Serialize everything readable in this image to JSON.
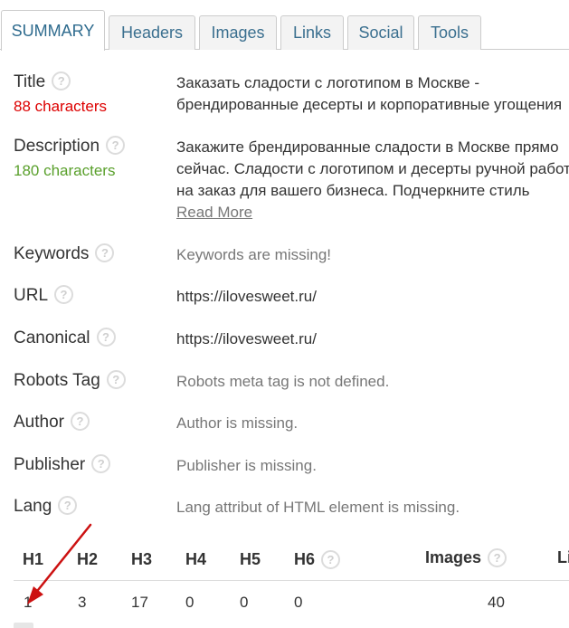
{
  "tabs": [
    {
      "label": "SUMMARY",
      "active": true
    },
    {
      "label": "Headers"
    },
    {
      "label": "Images"
    },
    {
      "label": "Links"
    },
    {
      "label": "Social"
    },
    {
      "label": "Tools"
    }
  ],
  "help_glyph": "?",
  "title": {
    "label": "Title",
    "count": "88 characters",
    "lines": [
      "Заказать сладости с логотипом в Москве -",
      "брендированные десерты и корпоративные угощения"
    ]
  },
  "description": {
    "label": "Description",
    "count": "180 characters",
    "lines": [
      "Закажите брендированные сладости в Москве прямо",
      "сейчас. Сладости с логотипом и десерты ручной работы",
      "на заказ для вашего бизнеса. Подчеркните стиль"
    ],
    "read_more": "Read More"
  },
  "keywords": {
    "label": "Keywords",
    "value": "Keywords are missing!"
  },
  "url": {
    "label": "URL",
    "value": "https://ilovesweet.ru/"
  },
  "canonical": {
    "label": "Canonical",
    "value": "https://ilovesweet.ru/"
  },
  "robots": {
    "label": "Robots Tag",
    "value": "Robots meta tag is not defined."
  },
  "author": {
    "label": "Author",
    "value": "Author is missing."
  },
  "publisher": {
    "label": "Publisher",
    "value": "Publisher is missing."
  },
  "lang": {
    "label": "Lang",
    "value": "Lang attribut of HTML element is missing."
  },
  "counts_table": {
    "headers": [
      "H1",
      "H2",
      "H3",
      "H4",
      "H5",
      "H6",
      "Images",
      "Li"
    ],
    "values": [
      "1",
      "3",
      "17",
      "0",
      "0",
      "0",
      "40"
    ]
  },
  "colors": {
    "accent": "#2e6b8e",
    "warning": "#dd0000",
    "ok": "#5aa02c",
    "annotation": "#cc1111"
  }
}
